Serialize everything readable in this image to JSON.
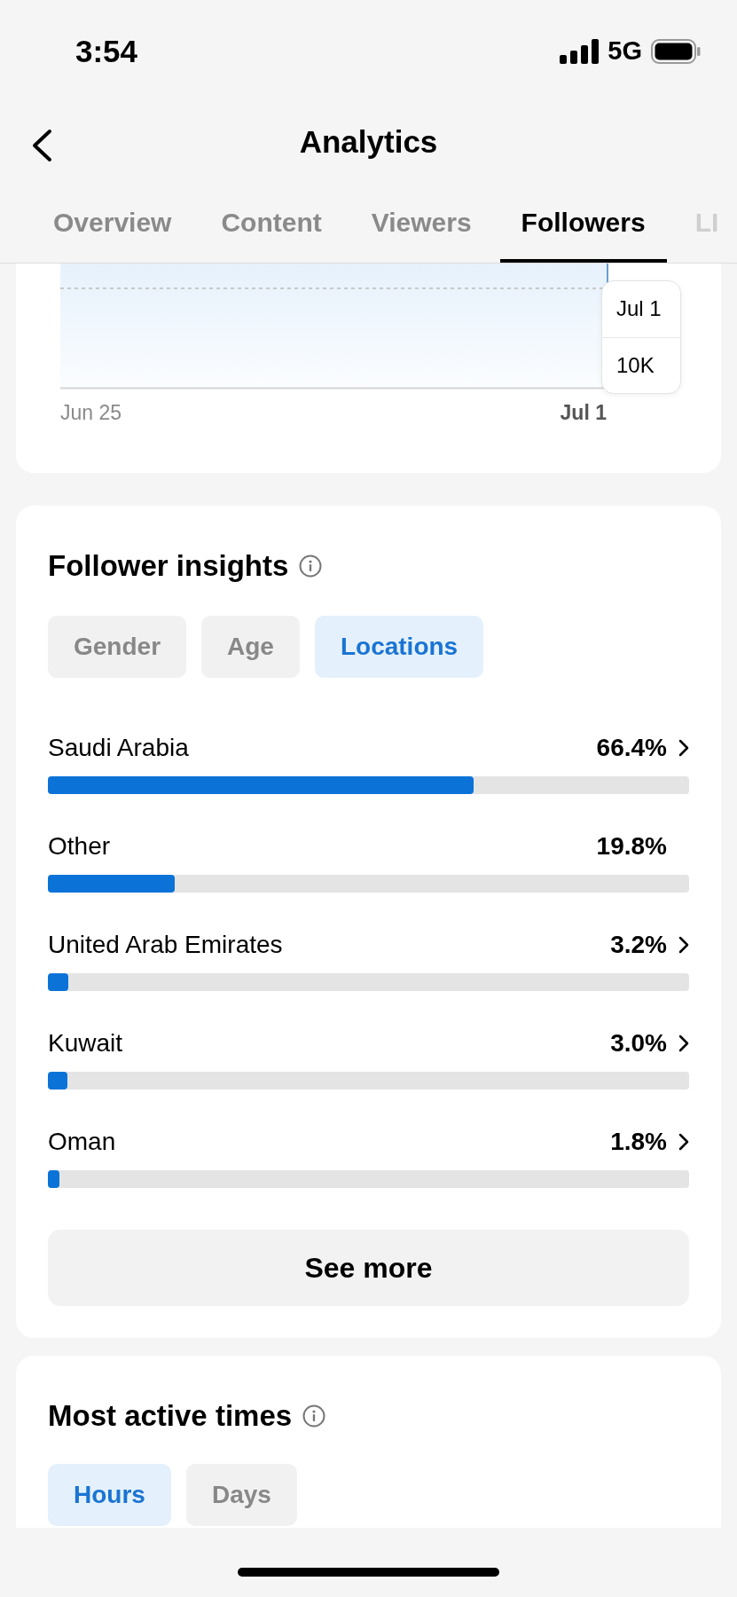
{
  "status_bar": {
    "time": "3:54",
    "network": "5G"
  },
  "header": {
    "title": "Analytics"
  },
  "tabs": [
    {
      "label": "Overview",
      "selected": false
    },
    {
      "label": "Content",
      "selected": false
    },
    {
      "label": "Viewers",
      "selected": false
    },
    {
      "label": "Followers",
      "selected": true
    },
    {
      "label": "LI",
      "selected": false
    }
  ],
  "followers_chart": {
    "x_labels": [
      "Jun 25",
      "Jul 1"
    ],
    "tooltip": {
      "date": "Jul 1",
      "value": "10K"
    }
  },
  "follower_insights": {
    "title": "Follower insights",
    "filters": [
      {
        "label": "Gender",
        "selected": false
      },
      {
        "label": "Age",
        "selected": false
      },
      {
        "label": "Locations",
        "selected": true
      }
    ],
    "locations": [
      {
        "name": "Saudi Arabia",
        "percent": "66.4%",
        "level": 0.664,
        "chevron": true
      },
      {
        "name": "Other",
        "percent": "19.8%",
        "level": 0.198,
        "chevron": false
      },
      {
        "name": "United Arab Emirates",
        "percent": "3.2%",
        "level": 0.032,
        "chevron": true
      },
      {
        "name": "Kuwait",
        "percent": "3.0%",
        "level": 0.03,
        "chevron": true
      },
      {
        "name": "Oman",
        "percent": "1.8%",
        "level": 0.018,
        "chevron": true
      }
    ],
    "see_more": "See more"
  },
  "most_active_times": {
    "title": "Most active times",
    "filters": [
      {
        "label": "Hours",
        "selected": true
      },
      {
        "label": "Days",
        "selected": false
      }
    ]
  }
}
